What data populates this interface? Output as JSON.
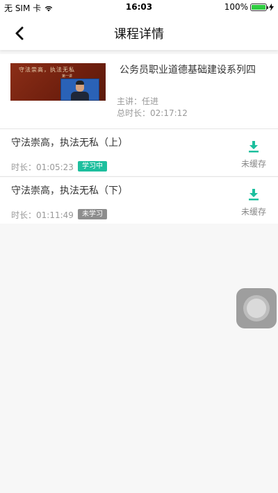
{
  "status": {
    "carrier": "无 SIM 卡",
    "time": "16:03",
    "battery": "100%",
    "battery_level": 1.0
  },
  "nav": {
    "title": "课程详情"
  },
  "course": {
    "title": "公务员职业道德基础建设系列四",
    "lecturer": "主讲：任进",
    "total_duration": "总时长：02:17:12",
    "thumbnail_caption": "守法崇高，执法无私",
    "thumbnail_sub": "第一讲"
  },
  "lessons": [
    {
      "title": "守法崇高，执法无私（上）",
      "duration": "时长：01:05:23",
      "status": "学习中",
      "download_label": "未缓存"
    },
    {
      "title": "守法崇高，执法无私（下）",
      "duration": "时长：01:11:49",
      "status": "未学习",
      "download_label": "未缓存"
    }
  ],
  "colors": {
    "accent": "#1dbf9e",
    "idle_badge": "#8d8d8d"
  }
}
